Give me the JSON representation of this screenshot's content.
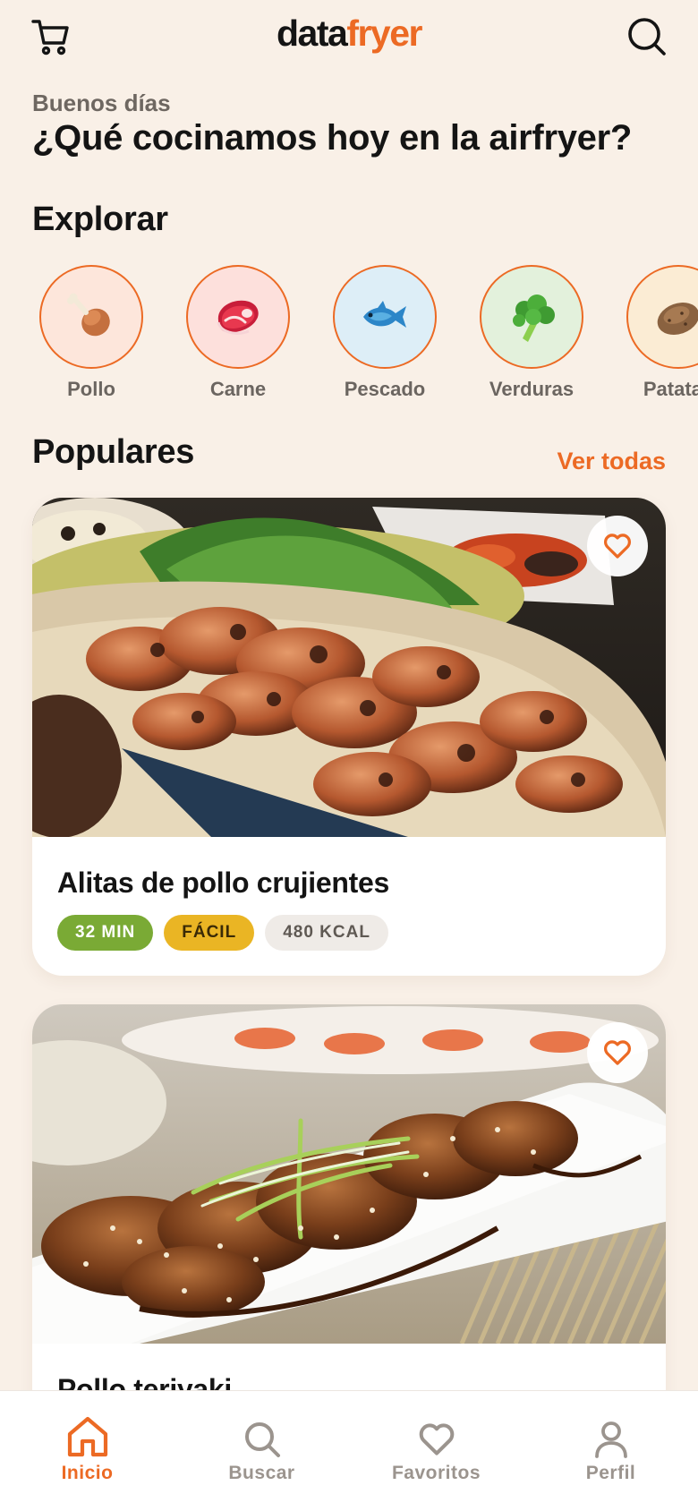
{
  "app": {
    "logo_part1": "data",
    "logo_part2": "fryer",
    "accent_color": "#ec6a24"
  },
  "header": {
    "cart_icon": "cart-icon",
    "search_icon": "search-icon"
  },
  "greeting": {
    "subtitle": "Buenos días",
    "title": "¿Qué cocinamos hoy en la airfryer?"
  },
  "explore": {
    "title": "Explorar",
    "categories": [
      {
        "label": "Pollo",
        "icon": "chicken-leg-icon",
        "bg": "#fde6db"
      },
      {
        "label": "Carne",
        "icon": "steak-icon",
        "bg": "#fde0dc"
      },
      {
        "label": "Pescado",
        "icon": "fish-icon",
        "bg": "#ddeef7"
      },
      {
        "label": "Verduras",
        "icon": "broccoli-icon",
        "bg": "#e3f1dc"
      },
      {
        "label": "Patatas",
        "icon": "potato-icon",
        "bg": "#fbecd4"
      }
    ]
  },
  "popular": {
    "title": "Populares",
    "see_all": "Ver todas",
    "recipes": [
      {
        "title": "Alitas de pollo crujientes",
        "image": "chicken-wings-photo",
        "time": "32 MIN",
        "difficulty": "FÁCIL",
        "calories": "480 KCAL"
      },
      {
        "title": "Pollo teriyaki",
        "image": "teriyaki-chicken-photo"
      }
    ]
  },
  "bottom_nav": {
    "items": [
      {
        "label": "Inicio",
        "icon": "home-icon",
        "active": true
      },
      {
        "label": "Buscar",
        "icon": "search-icon",
        "active": false
      },
      {
        "label": "Favoritos",
        "icon": "heart-icon",
        "active": false
      },
      {
        "label": "Perfil",
        "icon": "user-icon",
        "active": false
      }
    ]
  }
}
